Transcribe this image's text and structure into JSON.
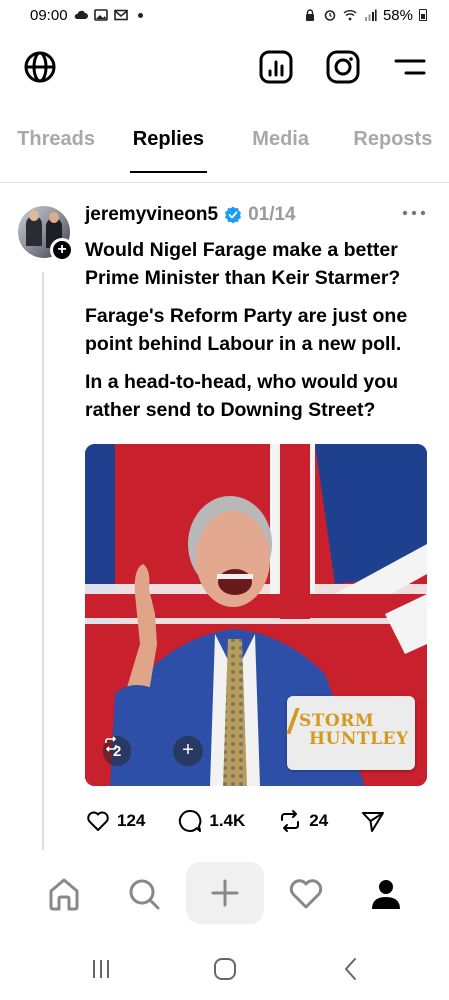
{
  "status_bar": {
    "time": "09:00",
    "battery": "58%",
    "left_icons": [
      "cloud-icon",
      "image-icon",
      "gmail-icon",
      "dot-icon"
    ],
    "right_icons": [
      "lock-icon",
      "alarm-icon",
      "wifi-icon",
      "signal-icon",
      "battery-icon"
    ]
  },
  "app_bar": {
    "icons": [
      "globe-icon",
      "insights-icon",
      "instagram-icon",
      "menu-icon"
    ]
  },
  "tabs": [
    {
      "label": "Threads",
      "active": false
    },
    {
      "label": "Replies",
      "active": true
    },
    {
      "label": "Media",
      "active": false
    },
    {
      "label": "Reposts",
      "active": false
    }
  ],
  "post": {
    "username": "jeremyvineon5",
    "verified": true,
    "date": "01/14",
    "paragraphs": [
      "Would Nigel Farage make a better Prime Minister than Keir Starmer?",
      "Farage's Reform Party are just one point behind Labour in a new poll.",
      "In a head-to-head, who would you rather send to Downing Street?"
    ],
    "media": {
      "repost_count": "2",
      "watermark_line1": "STORM",
      "watermark_line2": "HUNTLEY"
    },
    "actions": {
      "likes": "124",
      "replies": "1.4K",
      "reposts": "24"
    }
  },
  "bottom_nav": [
    "home-icon",
    "search-icon",
    "compose-icon",
    "activity-icon",
    "profile-icon"
  ],
  "system_nav": [
    "recents-icon",
    "home-circle-icon",
    "back-icon"
  ],
  "colors": {
    "verified_blue": "#1d9bf0",
    "inactive_tab": "#a8a8a8",
    "accent_gold": "#d49a1f"
  }
}
